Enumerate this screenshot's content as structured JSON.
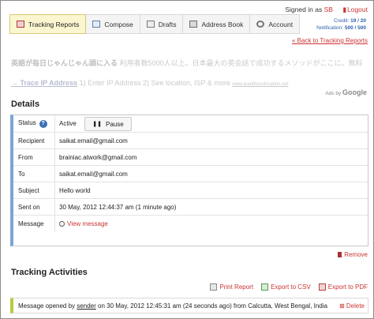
{
  "header": {
    "signed_in_prefix": "Signed in as",
    "user": "SB",
    "logout": "Logout",
    "credit_label": "Credit:",
    "credit_value": "19 / 20",
    "notification_label": "Notification:",
    "notification_value": "500 / 500"
  },
  "tabs": [
    {
      "label": "Tracking Reports",
      "icon": "report-icon",
      "active": true
    },
    {
      "label": "Compose",
      "icon": "compose-icon"
    },
    {
      "label": "Drafts",
      "icon": "drafts-icon"
    },
    {
      "label": "Address Book",
      "icon": "address-book-icon"
    },
    {
      "label": "Account",
      "icon": "gear-icon"
    }
  ],
  "back_link": "« Back to Tracking Reports",
  "ads": {
    "line1_title": "英語が毎日じゃんじゃん頭に入る",
    "line1_text": "利用者数5000人以上。日本最大の英会話で成功するメソッドがここに。無料",
    "line2_title": "→ Trace IP Address",
    "line2_text": "1) Enter IP Address 2) See location, ISP & more",
    "line2_small": "www.ipaddresslocation.net",
    "ads_by": "Ads by",
    "google": "Google"
  },
  "details": {
    "heading": "Details",
    "status_label": "Status",
    "status_value": "Active",
    "pause_label": "Pause",
    "recipient_label": "Recipient",
    "recipient_value": "saikat.email@gmail.com",
    "from_label": "From",
    "from_value": "brainiac.atwork@gmail.com",
    "to_label": "To",
    "to_value": "saikat.email@gmail.com",
    "subject_label": "Subject",
    "subject_value": "Hello world",
    "sent_label": "Sent on",
    "sent_value": "30 May, 2012 12:44:37 am (1 minute ago)",
    "message_label": "Message",
    "view_message": "View message"
  },
  "remove_label": "Remove",
  "tracking": {
    "heading": "Tracking Activities",
    "print_report": "Print Report",
    "export_csv": "Export to CSV",
    "export_pdf": "Export to PDF",
    "activity_prefix": "Message opened by",
    "activity_sender": "sender",
    "activity_suffix": "on 30 May, 2012 12:45:31 am (24 seconds ago) from Calcutta, West Bengal, India",
    "delete_label": "Delete"
  }
}
